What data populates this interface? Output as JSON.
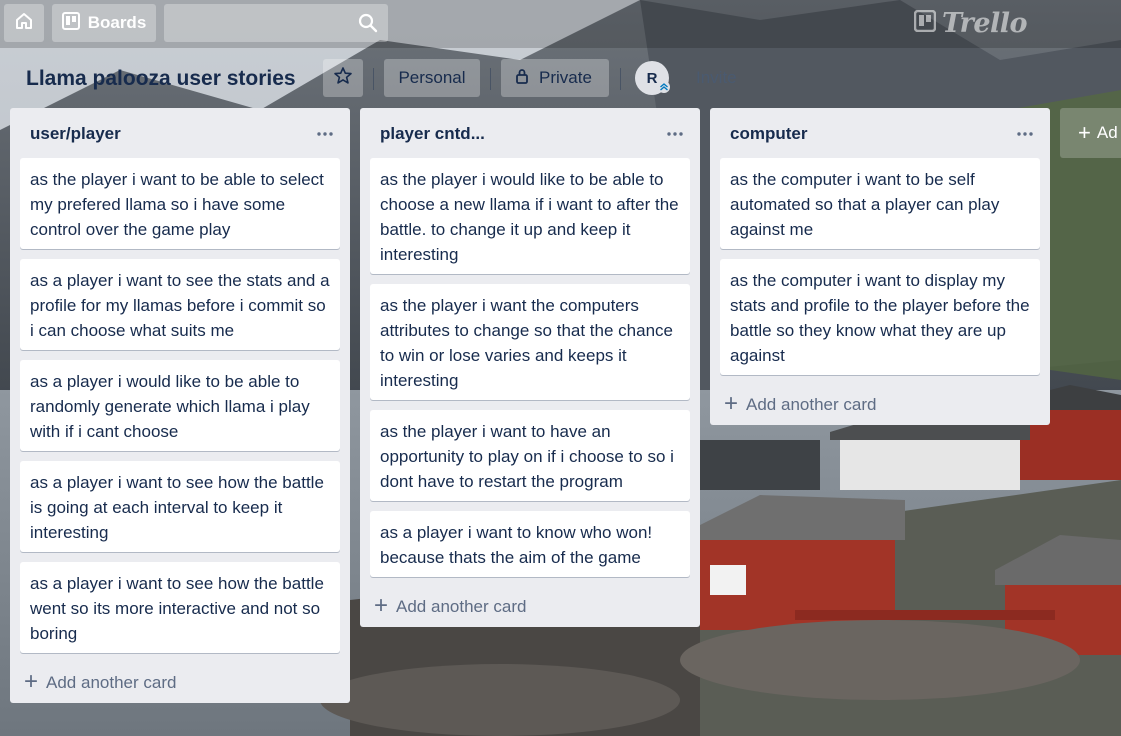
{
  "header": {
    "boards_label": "Boards",
    "search_placeholder": "",
    "logo_text": "Trello"
  },
  "board": {
    "title": "Llama palooza user stories",
    "team_label": "Personal",
    "visibility_label": "Private",
    "member_initial": "R",
    "invite_label": "Invite"
  },
  "lists": [
    {
      "title": "user/player",
      "cards": [
        "as the player i want to be able to select my prefered llama so i have some control over the game play",
        "as a player i want to see the stats and a profile for my llamas before i commit so i can choose what suits me",
        "as a player i would like to be able to randomly generate which llama i play with if i cant choose",
        "as a player i want to see how the battle is going at each interval to keep it interesting",
        "as a player i want to see how the battle went so its more interactive and not so boring"
      ],
      "add_card_label": "Add another card"
    },
    {
      "title": "player cntd...",
      "cards": [
        "as the player i would like to be able to choose a new llama if i want to after the battle. to change it up and keep it interesting",
        "as the player i want the computers attributes to change so that the chance to win or lose varies and keeps it interesting",
        "as the player i want to have an opportunity to play on if i choose to so i dont have to restart the program",
        "as a player i want to know who won! because thats the aim of the game"
      ],
      "add_card_label": "Add another card"
    },
    {
      "title": "computer",
      "cards": [
        "as the computer i want to be self automated so that a player can play against me",
        "as the computer i want to display my stats and profile to the player before the battle so they know what they are up against"
      ],
      "add_card_label": "Add another card"
    }
  ],
  "add_list_label": "Ad",
  "colors": {
    "list_bg": "#ebecf0",
    "text_primary": "#172b4d",
    "text_muted": "#5e6c84",
    "card_bg": "#ffffff"
  },
  "icons": [
    "home-icon",
    "boards-icon",
    "search-icon",
    "trello-logo-icon",
    "star-icon",
    "lock-icon",
    "admin-chevron-icon",
    "more-icon",
    "plus-icon"
  ]
}
